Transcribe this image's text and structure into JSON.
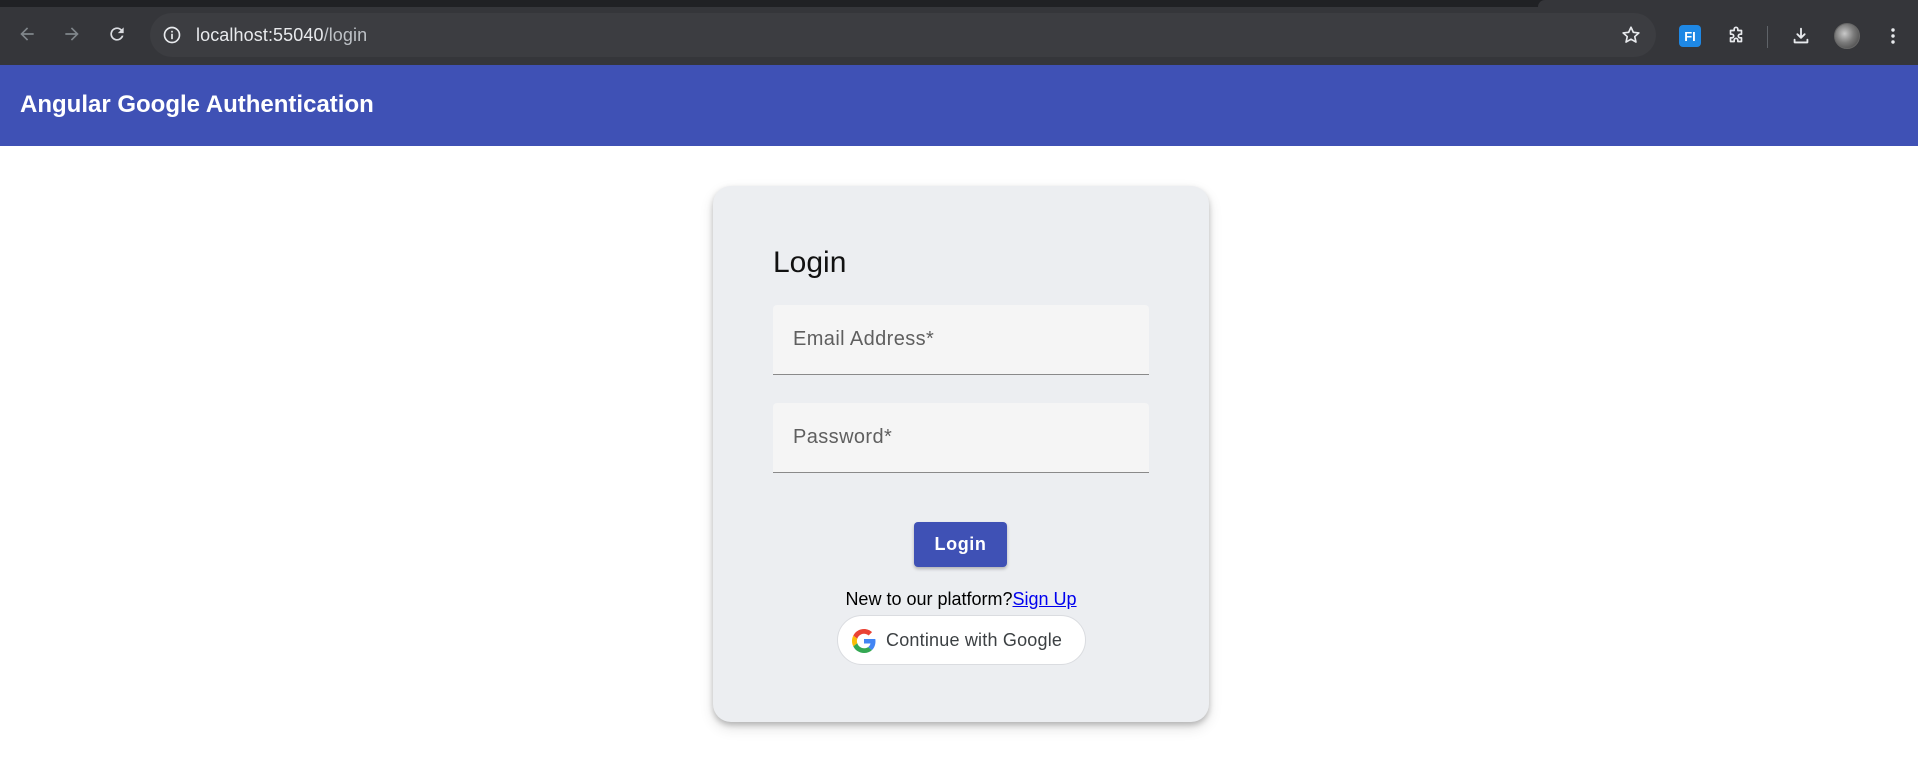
{
  "browser": {
    "url_host": "localhost:55040",
    "url_path": "/login",
    "icons": [
      "back-icon",
      "forward-icon",
      "reload-icon",
      "site-info-icon",
      "bookmark-star-icon",
      "extension-fi-icon",
      "extensions-puzzle-icon",
      "download-icon",
      "profile-avatar",
      "menu-kebab-icon"
    ],
    "extension_badge": "FI"
  },
  "appbar": {
    "title": "Angular Google Authentication",
    "color": "#3f51b5"
  },
  "login_card": {
    "heading": "Login",
    "email_placeholder": "Email Address*",
    "password_placeholder": "Password*",
    "login_button": "Login",
    "signup_prompt": "New to our platform?",
    "signup_link": "Sign Up",
    "google_button": "Continue with Google"
  }
}
